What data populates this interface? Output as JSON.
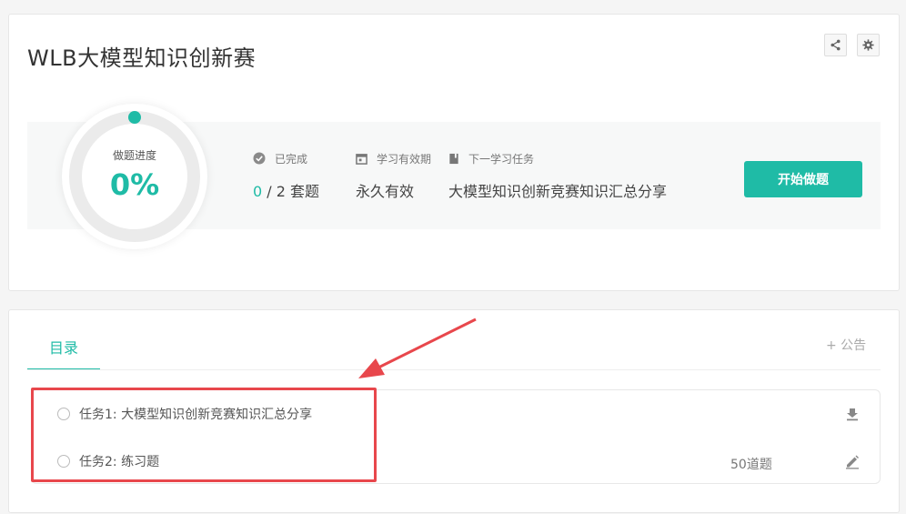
{
  "header": {
    "title": "WLB大模型知识创新赛",
    "share_icon": "share-icon",
    "settings_icon": "gear-icon"
  },
  "progress": {
    "label": "做题进度",
    "value_text": "0%",
    "fraction": 0,
    "accent": "#1fbba6"
  },
  "stats": {
    "completed": {
      "label": "已完成",
      "icon": "check-circle-icon",
      "done": "0",
      "rest": " / 2 套题"
    },
    "validity": {
      "label": "学习有效期",
      "icon": "calendar-icon",
      "value": "永久有效"
    },
    "next_task": {
      "label": "下一学习任务",
      "icon": "book-icon",
      "value": "大模型知识创新竞赛知识汇总分享"
    }
  },
  "actions": {
    "start_label": "开始做题"
  },
  "tabs": {
    "catalog_label": "目录",
    "notice_label": "+ 公告"
  },
  "tasks": [
    {
      "label": "任务1:  大模型知识创新竞赛知识汇总分享",
      "count": "",
      "icon": "download-icon"
    },
    {
      "label": "任务2:  练习题",
      "count": "50道题",
      "icon": "edit-pencil-icon"
    }
  ],
  "annotation": {
    "color": "#e8474c"
  }
}
